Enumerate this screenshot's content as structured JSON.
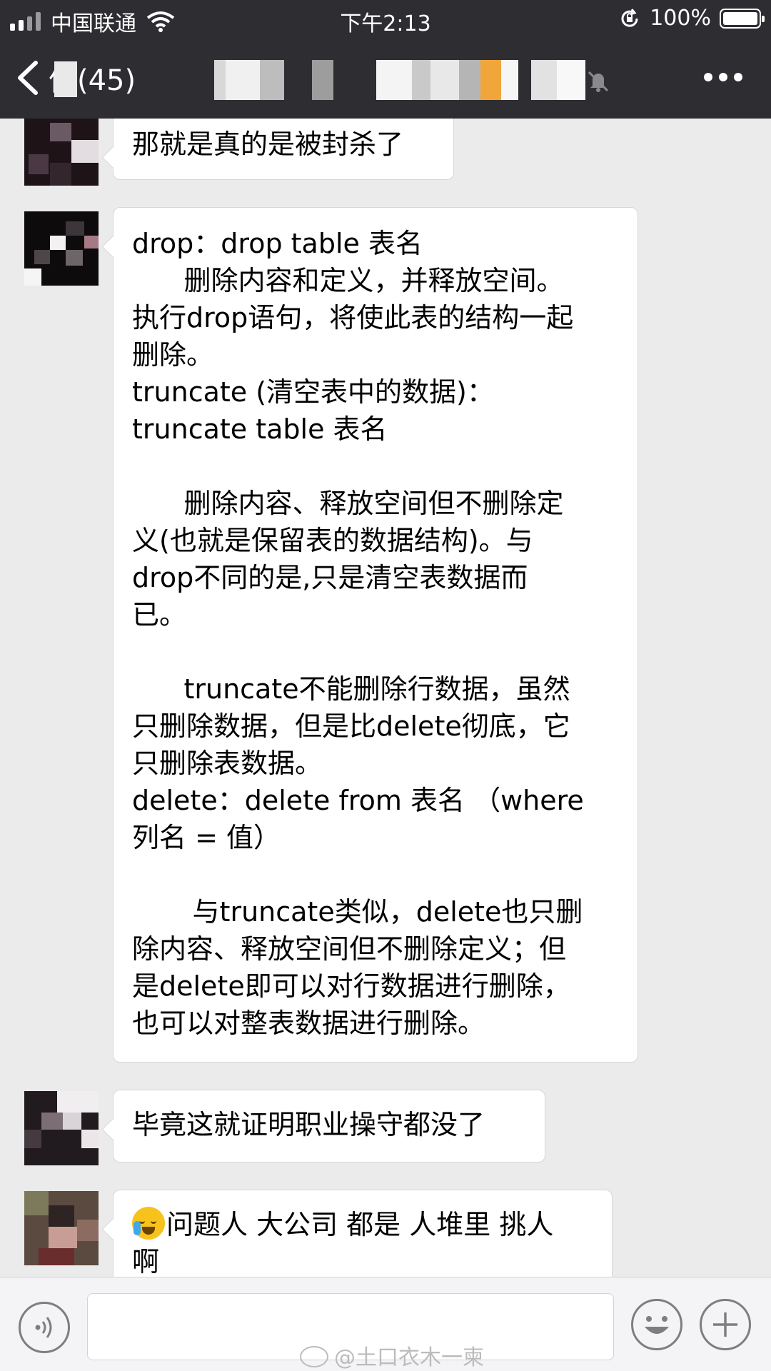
{
  "status_bar": {
    "carrier": "中国联通",
    "time": "下午2:13",
    "battery": "100%"
  },
  "nav": {
    "back_label": "信(45)",
    "title": "",
    "more_icon": "more-icon"
  },
  "messages": [
    {
      "lines": [
        "那就是真的是被封杀了"
      ]
    },
    {
      "lines": [
        "drop：drop table 表名",
        "      删除内容和定义，并释放空间。",
        "执行drop语句，将使此表的结构一起",
        "删除。",
        "truncate (清空表中的数据)：",
        "truncate table 表名",
        "",
        "      删除内容、释放空间但不删除定",
        "义(也就是保留表的数据结构)。与",
        "drop不同的是,只是清空表数据而",
        "已。",
        "",
        "      truncate不能删除行数据，虽然",
        "只删除数据，但是比delete彻底，它",
        "只删除表数据。",
        "delete：delete from 表名 （where",
        "列名 = 值）",
        "",
        "       与truncate类似，delete也只删",
        "除内容、释放空间但不删除定义；但",
        "是delete即可以对行数据进行删除，",
        "也可以对整表数据进行删除。"
      ]
    },
    {
      "lines": [
        "毕竟这就证明职业操守都没了"
      ]
    },
    {
      "lines": [
        "问题人 大公司 都是 人堆里 挑人",
        "啊"
      ]
    }
  ],
  "watermark": "@土口衣木一柬",
  "colors": {
    "bar": "#2e2e32",
    "chat_bg": "#ebebeb",
    "bubble": "#ffffff"
  }
}
